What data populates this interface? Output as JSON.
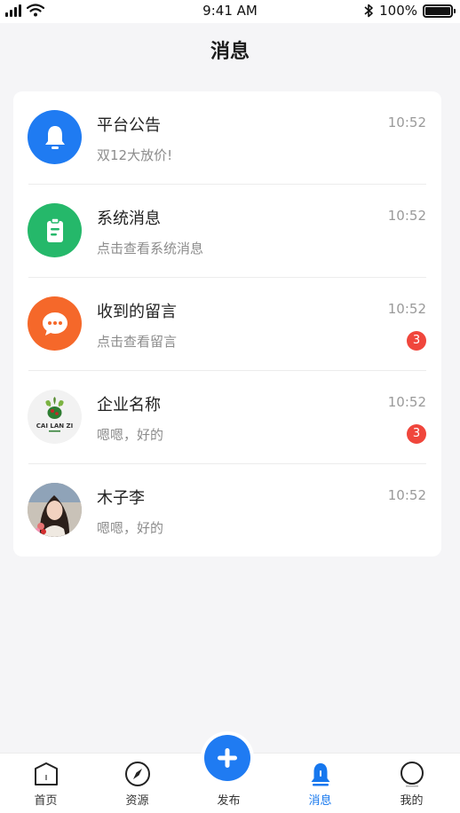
{
  "status_bar": {
    "time": "9:41 AM",
    "battery": "100%",
    "battery_level": 1.0
  },
  "header": {
    "title": "消息"
  },
  "messages": [
    {
      "title": "平台公告",
      "subtitle": "双12大放价!",
      "time": "10:52",
      "icon": "bell-icon",
      "color": "#1f7bf2"
    },
    {
      "title": "系统消息",
      "subtitle": "点击查看系统消息",
      "time": "10:52",
      "icon": "clipboard-icon",
      "color": "#25b86a"
    },
    {
      "title": "收到的留言",
      "subtitle": "点击查看留言",
      "time": "10:52",
      "badge": "3",
      "icon": "chat-bubble-icon",
      "color": "#f5682a"
    },
    {
      "title": "企业名称",
      "subtitle": "嗯嗯，好的",
      "time": "10:52",
      "badge": "3",
      "icon": "company-logo",
      "logo_text": "CAI LAN ZI"
    },
    {
      "title": "木子李",
      "subtitle": "嗯嗯，好的",
      "time": "10:52",
      "icon": "user-avatar"
    }
  ],
  "tab_bar": {
    "items": [
      {
        "label": "首页",
        "icon": "home-icon"
      },
      {
        "label": "资源",
        "icon": "compass-icon"
      },
      {
        "label": "发布",
        "icon": "plus-icon"
      },
      {
        "label": "消息",
        "icon": "bell-icon",
        "active": true
      },
      {
        "label": "我的",
        "icon": "profile-icon"
      }
    ],
    "active_color": "#1677ee"
  }
}
